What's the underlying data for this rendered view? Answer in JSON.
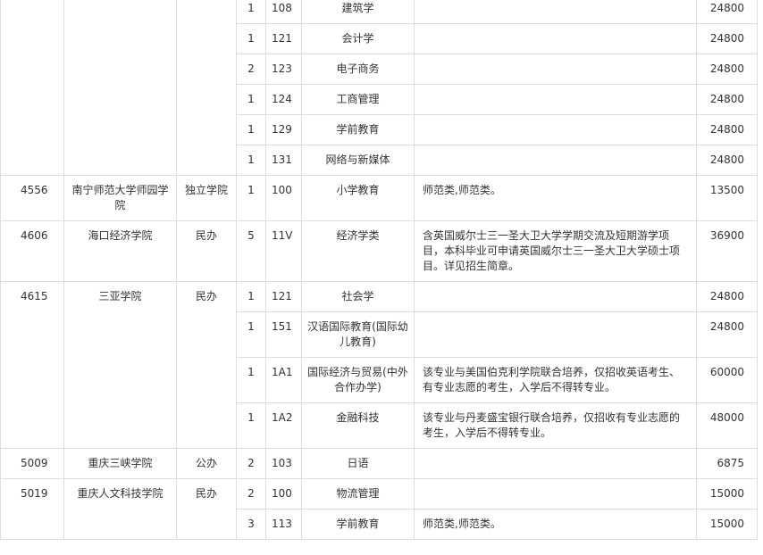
{
  "rows": [
    {
      "code": "",
      "name": "",
      "type": "",
      "count": "1",
      "mcode": "108",
      "major": "建筑学",
      "note": "",
      "fee": "24800"
    },
    {
      "code": "",
      "name": "",
      "type": "",
      "count": "1",
      "mcode": "121",
      "major": "会计学",
      "note": "",
      "fee": "24800"
    },
    {
      "code": "",
      "name": "",
      "type": "",
      "count": "2",
      "mcode": "123",
      "major": "电子商务",
      "note": "",
      "fee": "24800"
    },
    {
      "code": "",
      "name": "",
      "type": "",
      "count": "1",
      "mcode": "124",
      "major": "工商管理",
      "note": "",
      "fee": "24800"
    },
    {
      "code": "",
      "name": "",
      "type": "",
      "count": "1",
      "mcode": "129",
      "major": "学前教育",
      "note": "",
      "fee": "24800"
    },
    {
      "code": "",
      "name": "",
      "type": "",
      "count": "1",
      "mcode": "131",
      "major": "网络与新媒体",
      "note": "",
      "fee": "24800"
    },
    {
      "code": "4556",
      "name": "南宁师范大学师园学院",
      "type": "独立学院",
      "count": "1",
      "mcode": "100",
      "major": "小学教育",
      "note": "师范类,师范类。",
      "fee": "13500"
    },
    {
      "code": "4606",
      "name": "海口经济学院",
      "type": "民办",
      "count": "5",
      "mcode": "11V",
      "major": "经济学类",
      "note": "含英国威尔士三一圣大卫大学学期交流及短期游学项目，本科毕业可申请英国威尔士三一圣大卫大学硕士项目。详见招生简章。",
      "fee": "36900"
    },
    {
      "code": "4615",
      "name": "三亚学院",
      "type": "民办",
      "count": "1",
      "mcode": "121",
      "major": "社会学",
      "note": "",
      "fee": "24800"
    },
    {
      "code": "",
      "name": "",
      "type": "",
      "count": "1",
      "mcode": "151",
      "major": "汉语国际教育(国际幼儿教育)",
      "note": "",
      "fee": "24800"
    },
    {
      "code": "",
      "name": "",
      "type": "",
      "count": "1",
      "mcode": "1A1",
      "major": "国际经济与贸易(中外合作办学)",
      "note": "该专业与美国伯克利学院联合培养，仅招收英语考生、有专业志愿的考生，入学后不得转专业。",
      "fee": "60000"
    },
    {
      "code": "",
      "name": "",
      "type": "",
      "count": "1",
      "mcode": "1A2",
      "major": "金融科技",
      "note": "该专业与丹麦盛宝银行联合培养，仅招收有专业志愿的考生，入学后不得转专业。",
      "fee": "48000"
    },
    {
      "code": "5009",
      "name": "重庆三峡学院",
      "type": "公办",
      "count": "2",
      "mcode": "103",
      "major": "日语",
      "note": "",
      "fee": "6875"
    },
    {
      "code": "5019",
      "name": "重庆人文科技学院",
      "type": "民办",
      "count": "2",
      "mcode": "100",
      "major": "物流管理",
      "note": "",
      "fee": "15000"
    },
    {
      "code": "",
      "name": "",
      "type": "",
      "count": "3",
      "mcode": "113",
      "major": "学前教育",
      "note": "师范类,师范类。",
      "fee": "15000"
    }
  ]
}
